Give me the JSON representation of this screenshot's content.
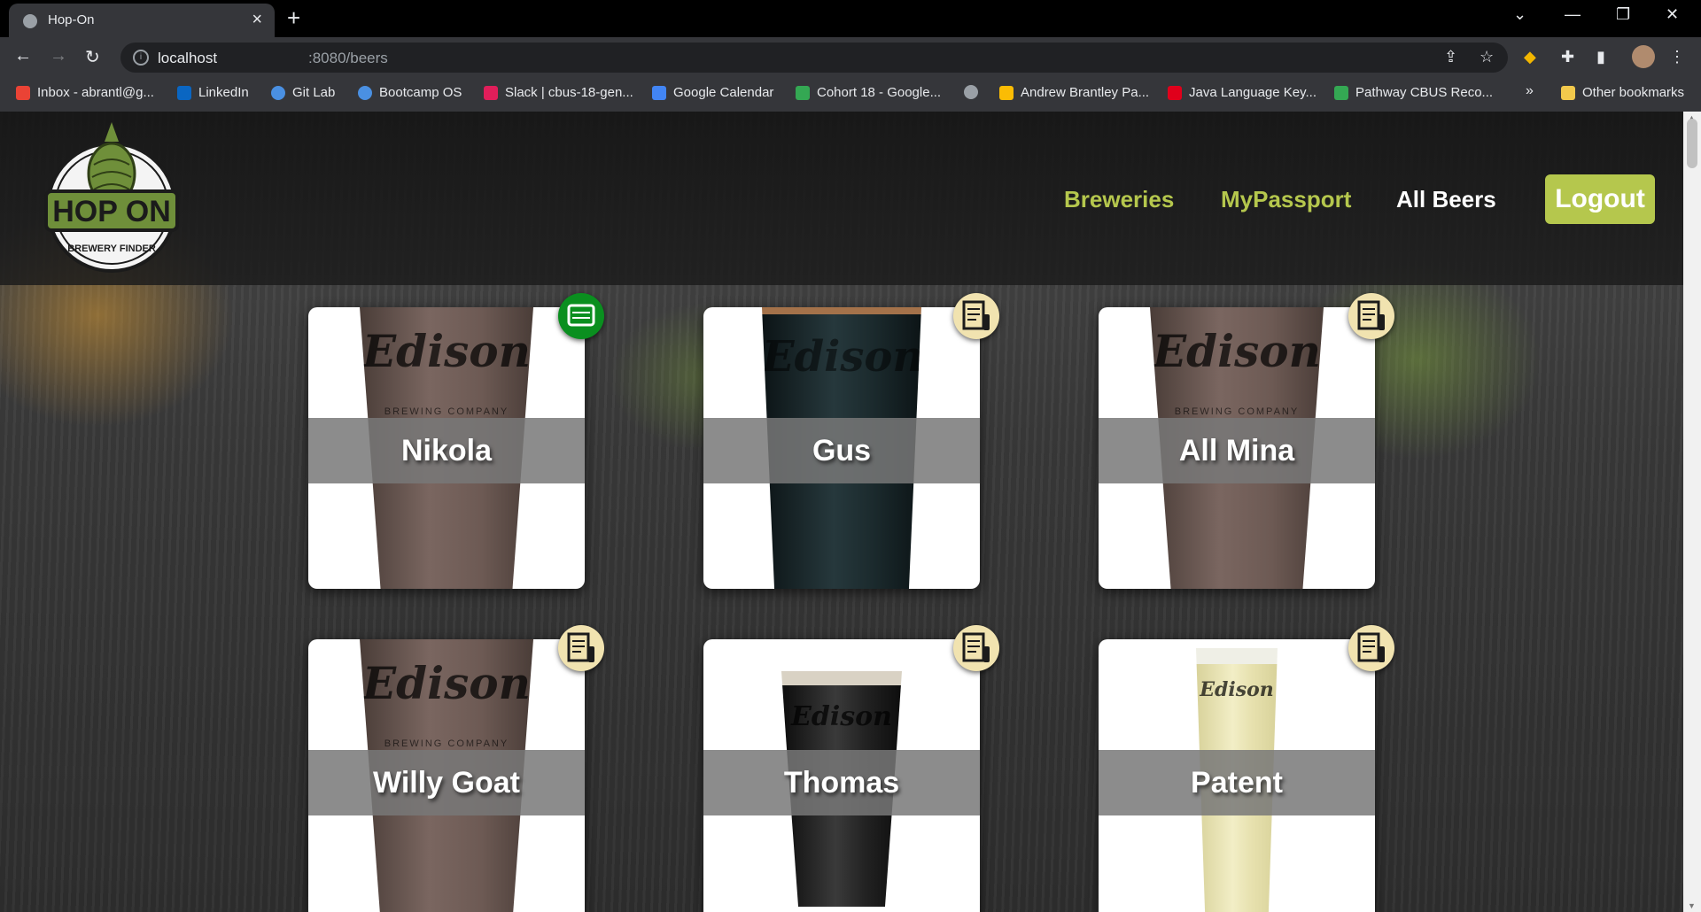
{
  "browser": {
    "tab_title": "Hop-On",
    "url_host": "localhost",
    "url_path": ":8080/beers",
    "bookmarks": [
      {
        "label": "Inbox - abrantl@g...",
        "icon": "gmail-icon",
        "color": "#ea4335"
      },
      {
        "label": "LinkedIn",
        "icon": "linkedin-icon",
        "color": "#0a66c2"
      },
      {
        "label": "Git Lab",
        "icon": "gitlab-icon",
        "color": "#4a90e2"
      },
      {
        "label": "Bootcamp OS",
        "icon": "bootcamp-icon",
        "color": "#4a90e2"
      },
      {
        "label": "Slack | cbus-18-gen...",
        "icon": "slack-icon",
        "color": "#e01e5a"
      },
      {
        "label": "Google Calendar",
        "icon": "calendar-icon",
        "color": "#4285f4"
      },
      {
        "label": "Cohort 18 - Google...",
        "icon": "drive-icon",
        "color": "#34a853"
      },
      {
        "label": "Andrew Brantley Pa...",
        "icon": "drive-icon",
        "color": "#fbbc04"
      },
      {
        "label": "Java Language Key...",
        "icon": "oracle-icon",
        "color": "#e0001b"
      },
      {
        "label": "Pathway CBUS Reco...",
        "icon": "drive-icon",
        "color": "#34a853"
      }
    ],
    "more_bookmarks": "»",
    "other_bookmarks": "Other bookmarks"
  },
  "site": {
    "logo_text": "HOP ON",
    "logo_subtext": "BREWERY FINDER",
    "nav": {
      "breweries": "Breweries",
      "passport": "MyPassport",
      "all_beers": "All Beers",
      "logout": "Logout"
    }
  },
  "beers": [
    {
      "name": "Nikola",
      "badge": "visited-stamp-icon",
      "glass": "pint-dark"
    },
    {
      "name": "Gus",
      "badge": "beer-menu-icon",
      "glass": "stout"
    },
    {
      "name": "All Mina",
      "badge": "beer-menu-icon",
      "glass": "pint-dark"
    },
    {
      "name": "Willy Goat",
      "badge": "beer-menu-icon",
      "glass": "pint-dark"
    },
    {
      "name": "Thomas",
      "badge": "beer-menu-icon",
      "glass": "nonic-stout"
    },
    {
      "name": "Patent",
      "badge": "beer-menu-icon",
      "glass": "pilsner"
    }
  ],
  "glass_etching": {
    "brand": "Edison",
    "sub": "BREWING COMPANY"
  },
  "colors": {
    "accent": "#b5c74d",
    "visited_badge": "#0a8f1f",
    "menu_badge": "#f1e3b0"
  }
}
